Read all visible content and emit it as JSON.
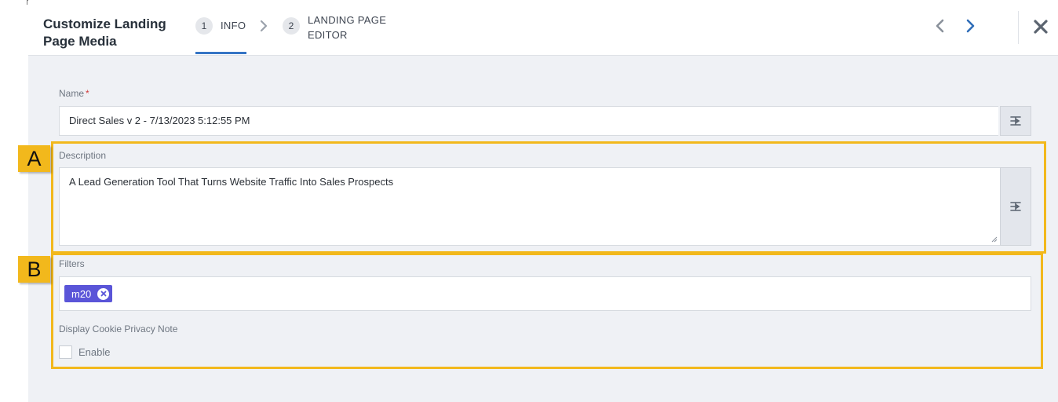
{
  "header": {
    "title": "Customize Landing Page Media",
    "steps": [
      {
        "number": "1",
        "label": "INFO"
      },
      {
        "number": "2",
        "label": "LANDING PAGE EDITOR"
      }
    ]
  },
  "form": {
    "name": {
      "label": "Name",
      "required_mark": "*",
      "value": "Direct Sales v 2 - 7/13/2023 5:12:55 PM"
    },
    "description": {
      "label": "Description",
      "value": "A Lead Generation Tool That Turns Website Traffic Into Sales Prospects"
    },
    "filters": {
      "label": "Filters",
      "tags": [
        "m20"
      ]
    },
    "cookie_note": {
      "label": "Display Cookie Privacy Note",
      "checkbox_label": "Enable",
      "checked": false
    }
  },
  "annotations": {
    "a": "A",
    "b": "B"
  },
  "colors": {
    "accent": "#3574c4",
    "chip": "#5a55d8",
    "callout": "#f2b81c",
    "required": "#d03b3b"
  },
  "icons": [
    "chevron-right-icon",
    "chevron-left-icon",
    "close-icon",
    "text-wrap-icon",
    "remove-tag-icon"
  ]
}
